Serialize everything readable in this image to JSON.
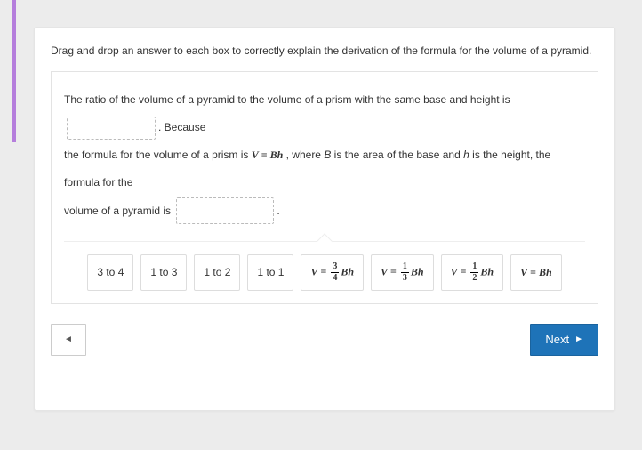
{
  "prompt": "Drag and drop an answer to each box to correctly explain the derivation of the formula for the volume of a pyramid.",
  "passage": {
    "p1a": "The ratio of the volume of a pyramid to the volume of a prism with the same base and height is",
    "p1b": ". Because",
    "p2a": "the formula for the volume of a prism is ",
    "p2b": " , where ",
    "p2c": " is the area of the base and ",
    "p2d": " is the height, the formula for the",
    "p3a": "volume of a pyramid is",
    "p3b": ".",
    "varB": "B",
    "varH": "h",
    "prismFormula": {
      "V": "V",
      "eq": "=",
      "Bh": "Bh"
    }
  },
  "tiles": {
    "t1": "3 to 4",
    "t2": "1 to 3",
    "t3": "1 to 2",
    "t4": "1 to 1",
    "f1": {
      "V": "V",
      "eq": "=",
      "num": "3",
      "den": "4",
      "Bh": "Bh"
    },
    "f2": {
      "V": "V",
      "eq": "=",
      "num": "1",
      "den": "3",
      "Bh": "Bh"
    },
    "f3": {
      "V": "V",
      "eq": "=",
      "num": "1",
      "den": "2",
      "Bh": "Bh"
    },
    "f4": {
      "V": "V",
      "eq": "=",
      "Bh": "Bh"
    }
  },
  "nav": {
    "next": "Next"
  }
}
